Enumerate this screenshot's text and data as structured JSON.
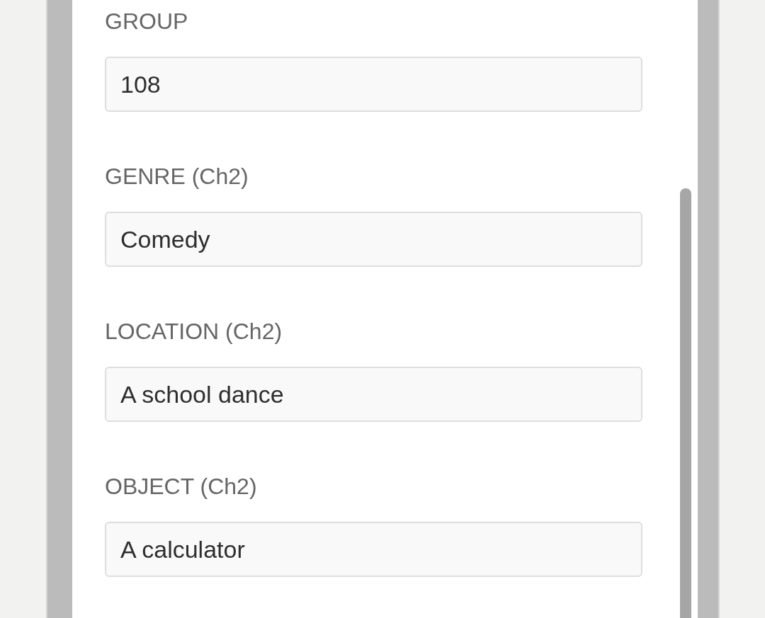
{
  "fields": [
    {
      "label": "GROUP",
      "value": "108"
    },
    {
      "label": "GENRE (Ch2)",
      "value": "Comedy"
    },
    {
      "label": "LOCATION (Ch2)",
      "value": "A school dance"
    },
    {
      "label": "OBJECT (Ch2)",
      "value": "A calculator"
    }
  ]
}
